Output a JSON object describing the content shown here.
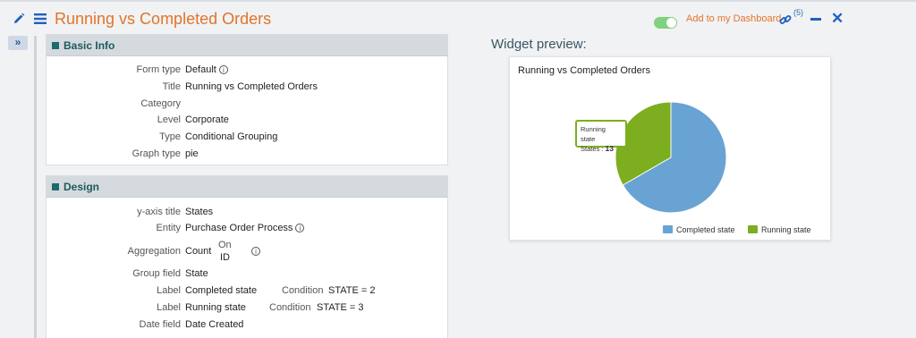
{
  "header": {
    "title": "Running vs Completed Orders",
    "dashboard_link": "Add to my Dashboard",
    "link_count": "(5)",
    "close_glyph": "✕",
    "expand_glyph": "»"
  },
  "basic_info": {
    "heading": "Basic Info",
    "rows": [
      {
        "label": "Form type",
        "value": "Default"
      },
      {
        "label": "Title",
        "value": "Running vs Completed Orders"
      },
      {
        "label": "Category",
        "value": ""
      },
      {
        "label": "Level",
        "value": "Corporate"
      },
      {
        "label": "Type",
        "value": "Conditional Grouping"
      },
      {
        "label": "Graph type",
        "value": "pie"
      }
    ]
  },
  "design": {
    "heading": "Design",
    "y_axis_title": {
      "label": "y-axis title",
      "value": "States"
    },
    "entity": {
      "label": "Entity",
      "value": "Purchase Order Process"
    },
    "aggregation": {
      "label": "Aggregation",
      "value": "Count",
      "on_label": "On",
      "on_value": "ID"
    },
    "group_field": {
      "label": "Group field",
      "value": "State"
    },
    "groups": [
      {
        "label": "Label",
        "value": "Completed state",
        "cond_label": "Condition",
        "cond_value": "STATE = 2"
      },
      {
        "label": "Label",
        "value": "Running state",
        "cond_label": "Condition",
        "cond_value": "STATE = 3"
      }
    ],
    "date_field": {
      "label": "Date field",
      "value": "Date Created"
    }
  },
  "preview": {
    "heading": "Widget preview:",
    "tooltip": {
      "series": "Running state",
      "label": "States :",
      "value": "13"
    }
  },
  "chart_data": {
    "type": "pie",
    "title": "Running vs Completed Orders",
    "categories": [
      "Completed state",
      "Running state"
    ],
    "values": [
      26,
      13
    ],
    "colors": [
      "#69a3d4",
      "#7cae1f"
    ],
    "legend_position": "bottom-right"
  }
}
